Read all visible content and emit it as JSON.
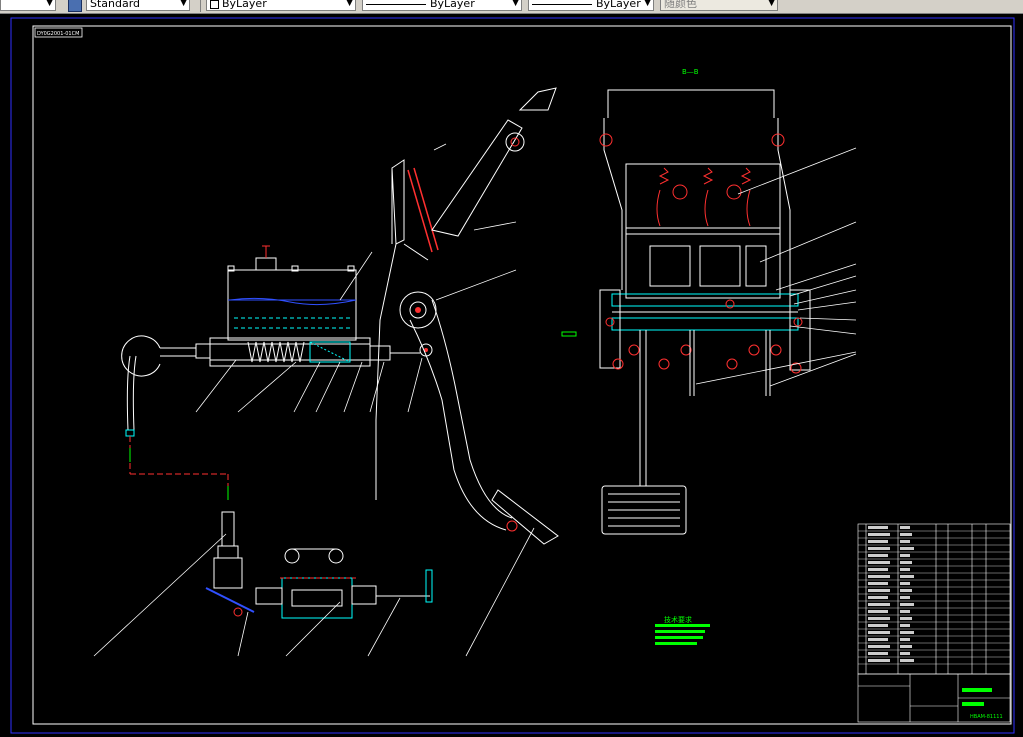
{
  "toolbar": {
    "text_style": "Standard",
    "color": "ByLayer",
    "linetype": "ByLayer",
    "lineweight": "ByLayer",
    "plot_style": "随颜色"
  },
  "drawing": {
    "title_tag": "DY0G2001-01CM",
    "section_label": "B—B",
    "tech_req_title": "技术要求",
    "drawing_number": "HBAM-81111"
  }
}
